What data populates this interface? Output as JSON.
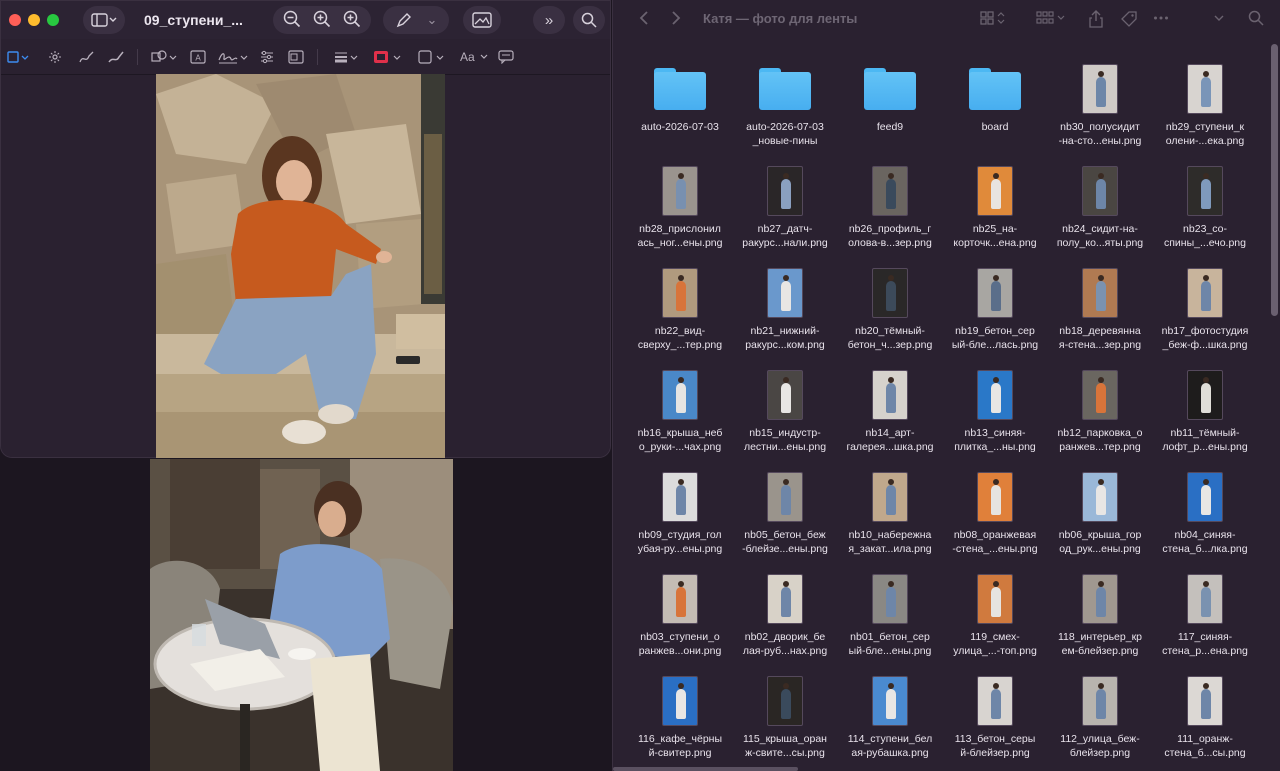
{
  "preview": {
    "title": "09_ступени_...",
    "toolbar_font_label": "Aa"
  },
  "finder": {
    "title": "Катя — фото для ленты",
    "items": [
      {
        "name": "auto-2026-07-03",
        "type": "folder"
      },
      {
        "name": "auto-2026-07-03\n_новые-пины",
        "type": "folder"
      },
      {
        "name": "feed9",
        "type": "folder"
      },
      {
        "name": "board",
        "type": "folder"
      },
      {
        "name": "nb30_полусидит\n-на-сто...ены.png",
        "type": "image",
        "bg": "#cfcac6",
        "fig": "#6d86a8"
      },
      {
        "name": "nb29_ступени_к\nолени-...ека.png",
        "type": "image",
        "bg": "#d8d4d0",
        "fig": "#7a95b8"
      },
      {
        "name": "nb28_прислонил\nась_ног...ены.png",
        "type": "image",
        "bg": "#9a948e",
        "fig": "#7890b0"
      },
      {
        "name": "nb27_датч-\nракурс...нали.png",
        "type": "image",
        "bg": "#2a2628",
        "fig": "#8aa0c0"
      },
      {
        "name": "nb26_профиль_г\nолова-в...зер.png",
        "type": "image",
        "bg": "#6a6560",
        "fig": "#3a4a5c"
      },
      {
        "name": "nb25_на-\nкорточк...ена.png",
        "type": "image",
        "bg": "#e08a3a",
        "fig": "#e8e4e0"
      },
      {
        "name": "nb24_сидит-на-\nполу_ко...яты.png",
        "type": "image",
        "bg": "#4a4642",
        "fig": "#6d86a8"
      },
      {
        "name": "nb23_со-\nспины_...ечо.png",
        "type": "image",
        "bg": "#2e2c2a",
        "fig": "#7f9abc"
      },
      {
        "name": "nb22_вид-\nсверху_...тер.png",
        "type": "image",
        "bg": "#b09a7e",
        "fig": "#d8743a"
      },
      {
        "name": "nb21_нижний-\nракурс...ком.png",
        "type": "image",
        "bg": "#6a98cc",
        "fig": "#e8e6e4"
      },
      {
        "name": "nb20_тёмный-\nбетон_ч...зер.png",
        "type": "image",
        "bg": "#2a2828",
        "fig": "#3c4a5a"
      },
      {
        "name": "nb19_бетон_сер\nый-бле...лась.png",
        "type": "image",
        "bg": "#a8a6a2",
        "fig": "#5a6e8a"
      },
      {
        "name": "nb18_деревянна\nя-стена...зер.png",
        "type": "image",
        "bg": "#b07a52",
        "fig": "#7a92b0"
      },
      {
        "name": "nb17_фотостудия\n_беж-ф...шка.png",
        "type": "image",
        "bg": "#c8b49c",
        "fig": "#6e86a8"
      },
      {
        "name": "nb16_крыша_неб\nо_руки-...чах.png",
        "type": "image",
        "bg": "#4a88c8",
        "fig": "#e6e4e2"
      },
      {
        "name": "nb15_индустр-\nлестни...ены.png",
        "type": "image",
        "bg": "#4a4644",
        "fig": "#e8e6e4"
      },
      {
        "name": "nb14_арт-\nгалерея...шка.png",
        "type": "image",
        "bg": "#d6d2cc",
        "fig": "#6e86a8"
      },
      {
        "name": "nb13_синяя-\nплитка_...ны.png",
        "type": "image",
        "bg": "#2a78c8",
        "fig": "#e8e6e4"
      },
      {
        "name": "nb12_парковка_о\nранжев...тер.png",
        "type": "image",
        "bg": "#6a6660",
        "fig": "#d8743a"
      },
      {
        "name": "nb11_тёмный-\nлофт_р...ены.png",
        "type": "image",
        "bg": "#1e1c1c",
        "fig": "#e0ded8"
      },
      {
        "name": "nb09_студия_гол\nубая-ру...ены.png",
        "type": "image",
        "bg": "#dcdcdc",
        "fig": "#6e86a8"
      },
      {
        "name": "nb05_бетон_беж\n-блейзе...ены.png",
        "type": "image",
        "bg": "#9a948c",
        "fig": "#6e86a8"
      },
      {
        "name": "nb10_набережна\nя_закат...ила.png",
        "type": "image",
        "bg": "#c0a88c",
        "fig": "#6e86a8"
      },
      {
        "name": "nb08_оранжевая\n-стена_...ены.png",
        "type": "image",
        "bg": "#e0803a",
        "fig": "#e6e4e0"
      },
      {
        "name": "nb06_крыша_гор\nод_рук...ены.png",
        "type": "image",
        "bg": "#9ab8d8",
        "fig": "#e8e6e4"
      },
      {
        "name": "nb04_синяя-\nстена_б...лка.png",
        "type": "image",
        "bg": "#2a6fc4",
        "fig": "#e8e6e4"
      },
      {
        "name": "nb03_ступени_о\nранжев...они.png",
        "type": "image",
        "bg": "#c4bcb4",
        "fig": "#d8743a"
      },
      {
        "name": "nb02_дворик_бе\nлая-руб...нах.png",
        "type": "image",
        "bg": "#d8d2c8",
        "fig": "#6e86a8"
      },
      {
        "name": "nb01_бетон_сер\nый-бле...ены.png",
        "type": "image",
        "bg": "#8a8884",
        "fig": "#6e86a8"
      },
      {
        "name": "119_смех-\nулица_...-топ.png",
        "type": "image",
        "bg": "#d07a3e",
        "fig": "#e6e4e0"
      },
      {
        "name": "118_интерьер_кр\nем-блейзер.png",
        "type": "image",
        "bg": "#a09890",
        "fig": "#6e86a8"
      },
      {
        "name": "117_синяя-\nстена_р...ена.png",
        "type": "image",
        "bg": "#c4c0bc",
        "fig": "#7a92b0"
      },
      {
        "name": "116_кафе_чёрны\nй-свитер.png",
        "type": "image",
        "bg": "#2a6fc4",
        "fig": "#e8e6e4"
      },
      {
        "name": "115_крыша_оран\nж-свите...сы.png",
        "type": "image",
        "bg": "#2a2624",
        "fig": "#3a4a5c"
      },
      {
        "name": "114_ступени_бел\nая-рубашка.png",
        "type": "image",
        "bg": "#4a8ad0",
        "fig": "#e8e6e4"
      },
      {
        "name": "113_бетон_серы\nй-блейзер.png",
        "type": "image",
        "bg": "#d8d4d0",
        "fig": "#6e86a8"
      },
      {
        "name": "112_улица_беж-\nблейзер.png",
        "type": "image",
        "bg": "#b8b4ae",
        "fig": "#6e86a8"
      },
      {
        "name": "111_оранж-\nстена_б...сы.png",
        "type": "image",
        "bg": "#dcd8d4",
        "fig": "#6e86a8"
      }
    ]
  }
}
